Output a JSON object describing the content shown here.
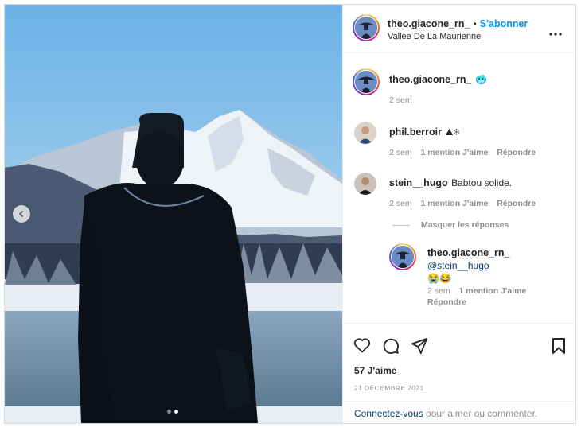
{
  "post": {
    "username": "theo.giacone_rn_",
    "separator": "•",
    "follow_label": "S'abonner",
    "location": "Vallee De La Maurienne",
    "caption_emoji": "🥶",
    "caption_time": "2 sem"
  },
  "comments": [
    {
      "username": "phil.berroir",
      "text": "⛰❄",
      "time": "2 sem",
      "likes": "1 mention J'aime",
      "reply": "Répondre"
    },
    {
      "username": "stein__hugo",
      "text": "Babtou solide.",
      "time": "2 sem",
      "likes": "1 mention J'aime",
      "reply": "Répondre"
    }
  ],
  "hide_replies_label": "Masquer les réponses",
  "reply": {
    "username": "theo.giacone_rn_",
    "mention": "@stein__hugo",
    "emojis": "😭😂",
    "time": "2 sem",
    "likes": "1 mention J'aime",
    "reply": "Répondre"
  },
  "footer": {
    "likes": "57 J'aime",
    "date": "21 DÉCEMBRE 2021",
    "login_link": "Connectez-vous",
    "login_rest": " pour aimer ou commenter."
  },
  "carousel": {
    "count": 2,
    "active_index": 1
  },
  "icons": {
    "like": "heart-icon",
    "comment": "comment-icon",
    "share": "share-icon",
    "save": "bookmark-icon",
    "more": "more-icon",
    "prev": "chevron-left-icon"
  },
  "colors": {
    "link": "#0095f6",
    "mention": "#00376b",
    "muted": "#8e8e8e"
  }
}
